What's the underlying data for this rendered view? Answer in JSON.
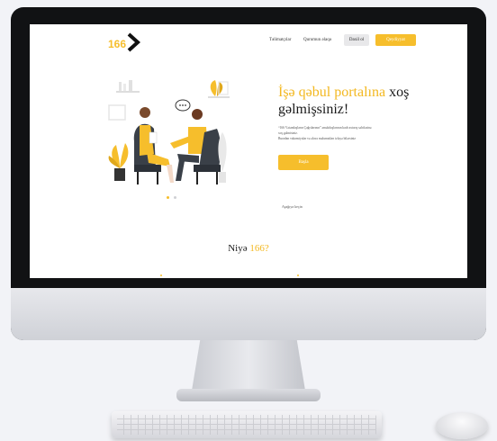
{
  "nav": {
    "logo_text": "166",
    "links": [
      "Təlimatçılar",
      "Qurumun əlaqə"
    ],
    "login_label": "Daxil ol",
    "register_label": "Qeydiyyat"
  },
  "hero": {
    "title_part1": "İşə qəbul portalına",
    "title_part2": " xoş",
    "title_part3": "gəlmişsiniz!",
    "desc_line1": "“166 Vətəndaşların Çağrılarının” əməkdaşlarının kadr axtarış səhifəsinə",
    "desc_line2": "xoş gəlmisiniz.",
    "desc_line3": "Buradan vakansiyalar və əlavə məlumatları izləyə bilərsiniz",
    "cta_label": "Başla"
  },
  "scroll_label": "Aşağıya keçin",
  "why": {
    "title_part1": "Niyə ",
    "title_part2": "166?"
  },
  "colors": {
    "accent": "#f6be2c",
    "text": "#1b1b1b"
  }
}
